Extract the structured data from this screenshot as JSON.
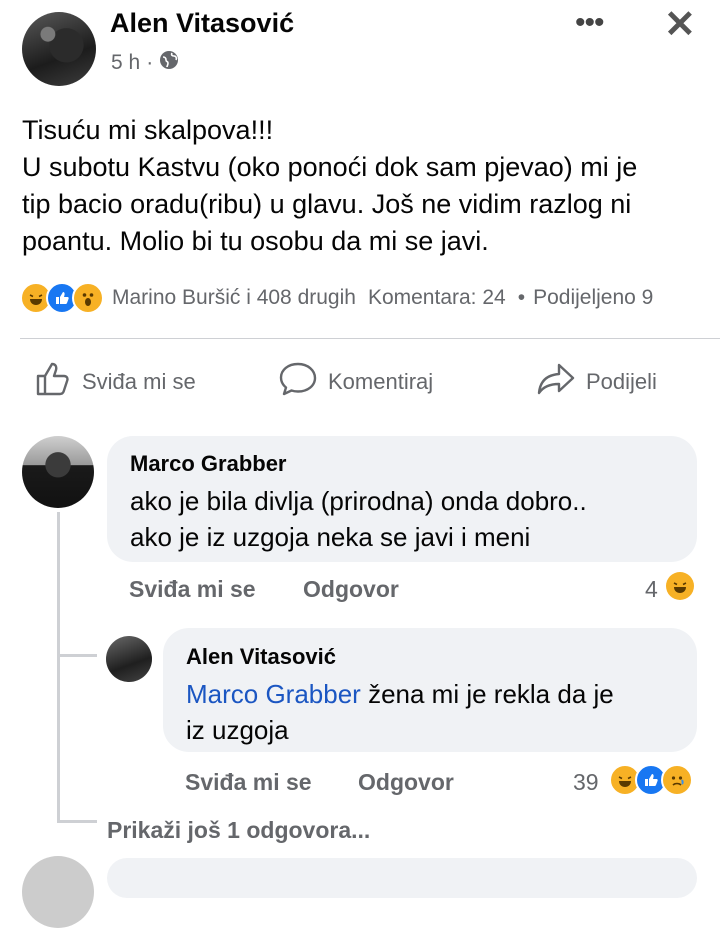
{
  "post": {
    "author": "Alen Vitasović",
    "time": "5 h",
    "meta_sep": "·",
    "text_lines": [
      "Tisuću mi skalpova!!!",
      "U subotu Kastvu (oko ponoći dok sam pjevao) mi je",
      "tip bacio oradu(ribu) u glavu. Još ne vidim razlog ni",
      "poantu. Molio bi tu osobu da mi se javi."
    ],
    "reaction_icons": [
      "haha-icon",
      "like-icon",
      "wow-icon"
    ],
    "reactions_text": "Marino Buršić i 408 drugih",
    "comments_count": "Komentara: 24",
    "bullet": "•",
    "shares": "Podijeljeno 9"
  },
  "actions": {
    "like": "Sviđa mi se",
    "comment": "Komentiraj",
    "share": "Podijeli"
  },
  "comments": [
    {
      "author": "Marco Grabber",
      "lines": [
        "ako je bila divlja (prirodna) onda dobro..",
        "ako je iz uzgoja neka se javi i meni"
      ],
      "like_label": "Sviđa mi se",
      "reply_label": "Odgovor",
      "reaction_count": "4"
    }
  ],
  "reply": {
    "author": "Alen Vitasović",
    "mention": "Marco Grabber",
    "line1_rest": " žena mi je rekla da je",
    "line2": "iz uzgoja",
    "like_label": "Sviđa mi se",
    "reply_label": "Odgovor",
    "reaction_count": "39"
  },
  "more_replies": "Prikaži još 1 odgovora...",
  "colors": {
    "link": "#1b56c2",
    "like_blue": "#1877f2",
    "haha_yellow": "#f7b125",
    "muted": "#65676b"
  }
}
